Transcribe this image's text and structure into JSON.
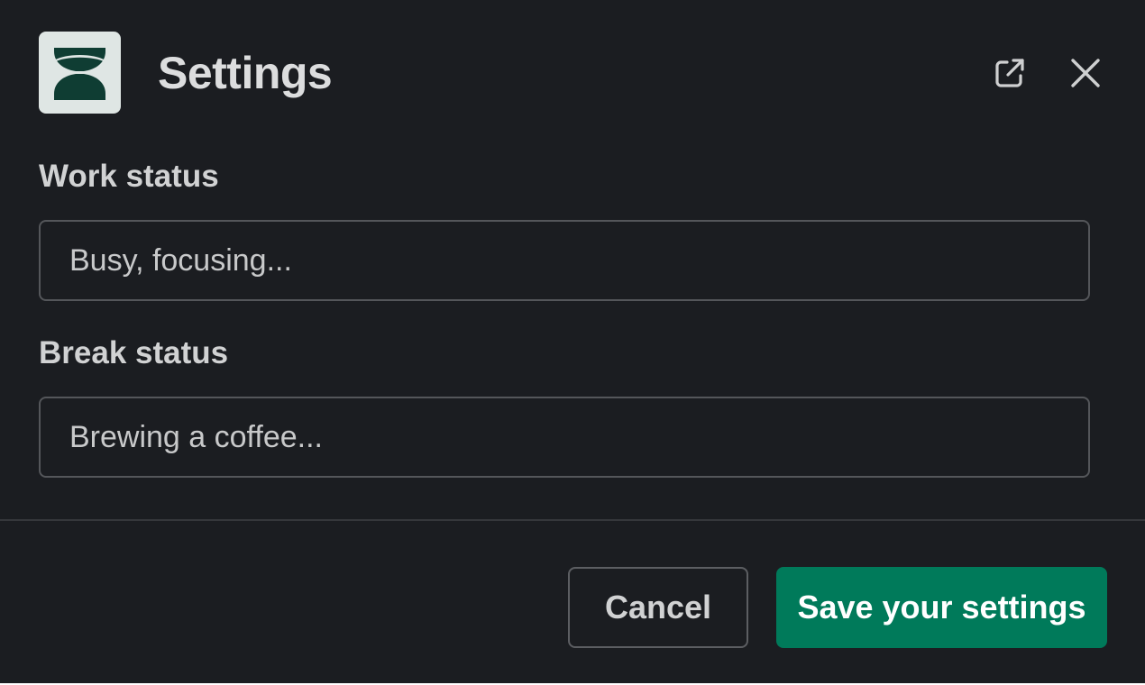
{
  "header": {
    "title": "Settings",
    "logo": "hourglass-logo-icon",
    "actions": [
      {
        "name": "open-in-new-window-icon"
      },
      {
        "name": "close-icon"
      }
    ]
  },
  "form": {
    "work_status": {
      "label": "Work status",
      "placeholder": "Busy, focusing..."
    },
    "break_status": {
      "label": "Break status",
      "placeholder": "Brewing a coffee..."
    }
  },
  "footer": {
    "cancel_label": "Cancel",
    "save_label": "Save your settings"
  },
  "colors": {
    "background": "#1b1d21",
    "primary": "#007a5a",
    "logo_background": "#dfe6e4",
    "logo_foreground": "#0f3d33"
  }
}
